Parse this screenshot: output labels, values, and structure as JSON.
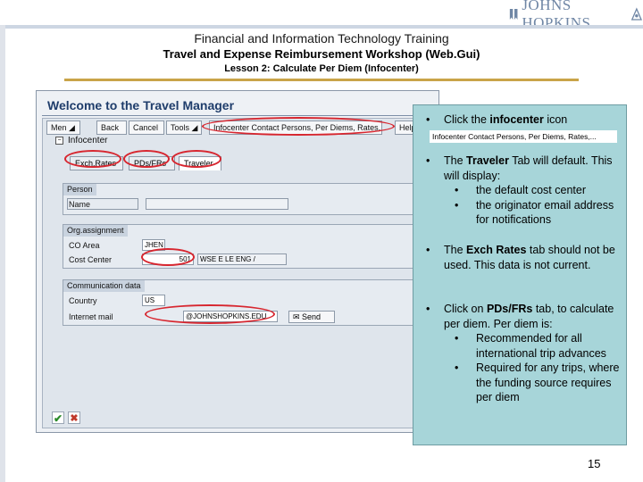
{
  "logo": {
    "text": "JOHNS HOPKINS"
  },
  "header": {
    "line1": "Financial and Information Technology Training",
    "line2": "Travel and Expense Reimbursement Workshop (Web.Gui)",
    "line3": "Lesson 2: Calculate Per Diem (Infocenter)"
  },
  "sap": {
    "window_title": "Welcome to the Travel Manager",
    "toolbar": {
      "menu": "Men ◢",
      "back": "Back",
      "cancel": "Cancel",
      "tools": "Tools ◢",
      "infocenter_btn": "Infocenter Contact Persons, Per Diems, Rates,...",
      "help": "Help"
    },
    "infocenter_label": "Infocenter",
    "tabs": {
      "exch_rates": "Exch.Rates",
      "pds_frs": "PDs/FRs",
      "traveler": "Traveler"
    },
    "person_group": {
      "title": "Person",
      "name_label": "Name",
      "name_value": ""
    },
    "org_group": {
      "title": "Org.assignment",
      "coarea_label": "CO Area",
      "coarea_value": "JHEN",
      "cost_center_label": "Cost Center",
      "cost_center_code": "501",
      "cost_center_name": "WSE E LE ENG /"
    },
    "comm_group": {
      "title": "Communication data",
      "country_label": "Country",
      "country_value": "US",
      "email_label": "Internet mail",
      "email_value": "@JOHNSHOPKINS.EDU",
      "send_label": "Send"
    },
    "status": {
      "ok": "✔",
      "cancel": "✖"
    }
  },
  "notes": {
    "b1": {
      "before": "Click the ",
      "bold": "infocenter",
      "after": " icon"
    },
    "callout": "Infocenter Contact Persons, Per Diems, Rates,...",
    "b2": {
      "before": "The ",
      "bold": "Traveler",
      "after": " Tab will default.  This will display:"
    },
    "b2_sub1": "the default cost center",
    "b2_sub2": "the originator email address for notifications",
    "b3": {
      "before": "The ",
      "bold": "Exch Rates",
      "after": " tab should not be used.  This data is not current."
    },
    "b4": {
      "before": "Click on ",
      "bold": "PDs/FRs",
      "after": " tab, to calculate per diem.  Per diem is:"
    },
    "b4_sub1": "Recommended for all international trip advances",
    "b4_sub2": "Required for any trips, where the funding source requires per diem",
    "bullet": "•",
    "sub_bullet": "•"
  },
  "page_number": "15",
  "colors": {
    "annotation": "#d7262f",
    "notes_bg": "#a7d5d9",
    "header_rule": "#c9a449",
    "sap_title": "#1f3d6b"
  }
}
